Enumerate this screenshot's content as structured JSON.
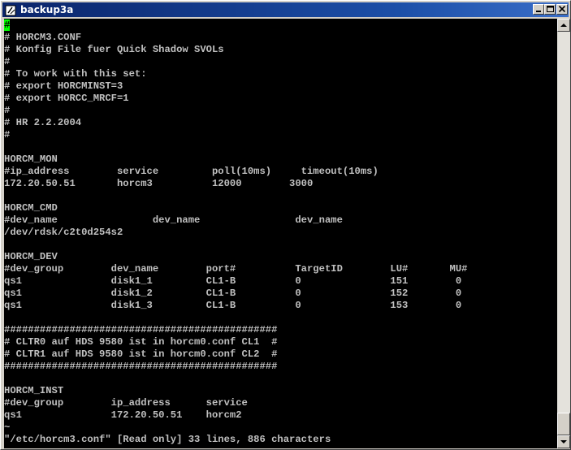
{
  "window": {
    "title": "backup3a",
    "buttons": {
      "minimize": "minimize",
      "maximize": "maximize",
      "close": "close"
    }
  },
  "terminal": {
    "cursor_char": "#",
    "first_line_rest": "",
    "lines": [
      "# HORCM3.CONF",
      "# Konfig File fuer Quick Shadow SVOLs",
      "#",
      "# To work with this set:",
      "# export HORCMINST=3",
      "# export HORCC_MRCF=1",
      "#",
      "# HR 2.2.2004",
      "#",
      "",
      "HORCM_MON",
      "#ip_address        service         poll(10ms)     timeout(10ms)",
      "172.20.50.51       horcm3          12000        3000",
      "",
      "HORCM_CMD",
      "#dev_name                dev_name                dev_name",
      "/dev/rdsk/c2t0d254s2",
      "",
      "HORCM_DEV",
      "#dev_group        dev_name        port#          TargetID        LU#       MU#",
      "qs1               disk1_1         CL1-B          0               151        0",
      "qs1               disk1_2         CL1-B          0               152        0",
      "qs1               disk1_3         CL1-B          0               153        0",
      "",
      "##############################################",
      "# CLTR0 auf HDS 9580 ist in horcm0.conf CL1  #",
      "# CLTR1 auf HDS 9580 ist in horcm0.conf CL2  #",
      "##############################################",
      "",
      "HORCM_INST",
      "#dev_group        ip_address      service",
      "qs1               172.20.50.51    horcm2",
      "~"
    ],
    "status_line": "\"/etc/horcm3.conf\" [Read only] 33 lines, 886 characters"
  },
  "icons": {
    "app": "terminal-app-icon",
    "scroll_up": "arrow-up-icon",
    "scroll_down": "arrow-down-icon"
  },
  "colors": {
    "titlebar": "#0a246a",
    "terminal_bg": "#000000",
    "terminal_fg": "#c0c0c0",
    "cursor": "#00ff00"
  }
}
